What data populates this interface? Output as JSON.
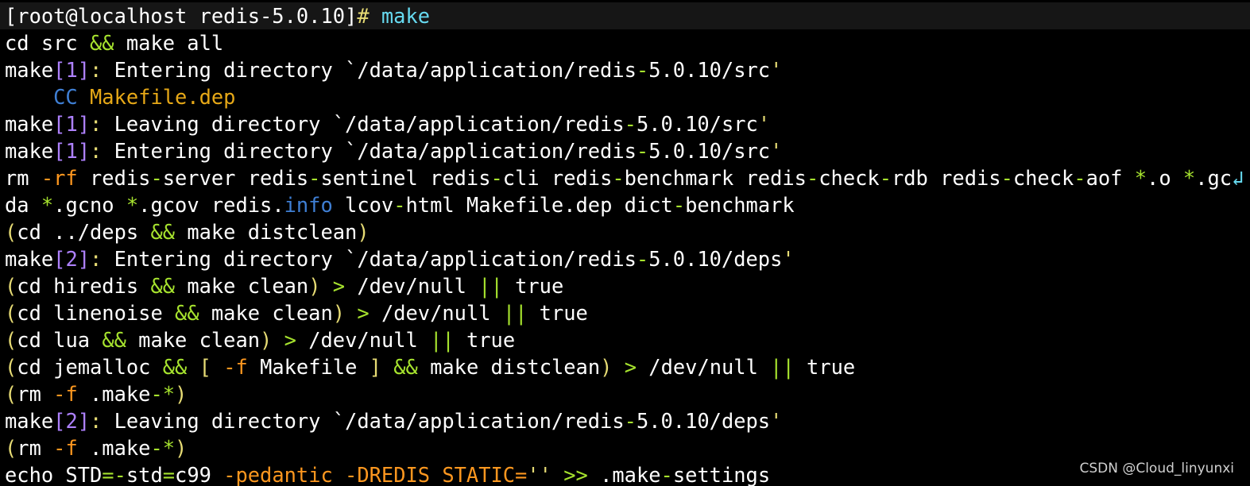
{
  "colors": {
    "background": "#000000",
    "prompt_background": "#161616",
    "text": "#ffffff",
    "operator": "#a6e22e",
    "bracket": "#ae81ff",
    "punctuation": "#e6db74",
    "option": "#fd971f",
    "builtin": "#66d9ef",
    "cc": "#3f7fd4",
    "makefile": "#e6a817",
    "watermark": "#d0d0d0"
  },
  "icons": {
    "wrap_marker": "line-wrap-icon"
  },
  "terminal": {
    "lines": [
      {
        "kind": "prompt",
        "segments": [
          {
            "text": "[root@localhost redis-5.0.10]",
            "color": "text"
          },
          {
            "text": "# ",
            "color": "punctuation"
          },
          {
            "text": "make",
            "color": "builtin"
          }
        ]
      },
      {
        "segments": [
          {
            "text": "cd src ",
            "color": "text"
          },
          {
            "text": "&&",
            "color": "operator"
          },
          {
            "text": " make all",
            "color": "text"
          }
        ]
      },
      {
        "segments": [
          {
            "text": "make",
            "color": "text"
          },
          {
            "text": "[1]",
            "color": "bracket"
          },
          {
            "text": ":",
            "color": "punctuation"
          },
          {
            "text": " Entering directory `/data/application/redis",
            "color": "text"
          },
          {
            "text": "-",
            "color": "operator"
          },
          {
            "text": "5.0.10/src",
            "color": "text"
          },
          {
            "text": "'",
            "color": "punctuation"
          }
        ]
      },
      {
        "segments": [
          {
            "text": "    CC ",
            "color": "cc"
          },
          {
            "text": "Makefile.dep",
            "color": "makefile"
          }
        ]
      },
      {
        "segments": [
          {
            "text": "make",
            "color": "text"
          },
          {
            "text": "[1]",
            "color": "bracket"
          },
          {
            "text": ":",
            "color": "punctuation"
          },
          {
            "text": " Leaving directory `/data/application/redis",
            "color": "text"
          },
          {
            "text": "-",
            "color": "operator"
          },
          {
            "text": "5.0.10/src",
            "color": "text"
          },
          {
            "text": "'",
            "color": "punctuation"
          }
        ]
      },
      {
        "segments": [
          {
            "text": "make",
            "color": "text"
          },
          {
            "text": "[1]",
            "color": "bracket"
          },
          {
            "text": ":",
            "color": "punctuation"
          },
          {
            "text": " Entering directory `/data/application/redis",
            "color": "text"
          },
          {
            "text": "-",
            "color": "operator"
          },
          {
            "text": "5.0.10/src",
            "color": "text"
          },
          {
            "text": "'",
            "color": "punctuation"
          }
        ]
      },
      {
        "segments": [
          {
            "text": "rm ",
            "color": "text"
          },
          {
            "text": "-rf",
            "color": "option"
          },
          {
            "text": " redis",
            "color": "text"
          },
          {
            "text": "-",
            "color": "operator"
          },
          {
            "text": "server redis",
            "color": "text"
          },
          {
            "text": "-",
            "color": "operator"
          },
          {
            "text": "sentinel redis",
            "color": "text"
          },
          {
            "text": "-",
            "color": "operator"
          },
          {
            "text": "cli redis",
            "color": "text"
          },
          {
            "text": "-",
            "color": "operator"
          },
          {
            "text": "benchmark redis",
            "color": "text"
          },
          {
            "text": "-",
            "color": "operator"
          },
          {
            "text": "check",
            "color": "text"
          },
          {
            "text": "-",
            "color": "operator"
          },
          {
            "text": "rdb redis",
            "color": "text"
          },
          {
            "text": "-",
            "color": "operator"
          },
          {
            "text": "check",
            "color": "text"
          },
          {
            "text": "-",
            "color": "operator"
          },
          {
            "text": "aof ",
            "color": "text"
          },
          {
            "text": "*",
            "color": "operator"
          },
          {
            "text": ".o ",
            "color": "text"
          },
          {
            "text": "*",
            "color": "operator"
          },
          {
            "text": ".gc",
            "color": "text"
          },
          {
            "text": "↲",
            "color": "builtin",
            "icon": "line-wrap-icon"
          }
        ]
      },
      {
        "segments": [
          {
            "text": "da ",
            "color": "text"
          },
          {
            "text": "*",
            "color": "operator"
          },
          {
            "text": ".gcno ",
            "color": "text"
          },
          {
            "text": "*",
            "color": "operator"
          },
          {
            "text": ".gcov redis.",
            "color": "text"
          },
          {
            "text": "info",
            "color": "cc"
          },
          {
            "text": " lcov",
            "color": "text"
          },
          {
            "text": "-",
            "color": "operator"
          },
          {
            "text": "html Makefile.dep dict",
            "color": "text"
          },
          {
            "text": "-",
            "color": "operator"
          },
          {
            "text": "benchmark",
            "color": "text"
          }
        ]
      },
      {
        "segments": [
          {
            "text": "(",
            "color": "punctuation"
          },
          {
            "text": "cd ../deps ",
            "color": "text"
          },
          {
            "text": "&&",
            "color": "operator"
          },
          {
            "text": " make distclean",
            "color": "text"
          },
          {
            "text": ")",
            "color": "punctuation"
          }
        ]
      },
      {
        "segments": [
          {
            "text": "make",
            "color": "text"
          },
          {
            "text": "[2]",
            "color": "bracket"
          },
          {
            "text": ":",
            "color": "punctuation"
          },
          {
            "text": " Entering directory `/data/application/redis",
            "color": "text"
          },
          {
            "text": "-",
            "color": "operator"
          },
          {
            "text": "5.0.10/deps",
            "color": "text"
          },
          {
            "text": "'",
            "color": "punctuation"
          }
        ]
      },
      {
        "segments": [
          {
            "text": "(",
            "color": "punctuation"
          },
          {
            "text": "cd hiredis ",
            "color": "text"
          },
          {
            "text": "&&",
            "color": "operator"
          },
          {
            "text": " make clean",
            "color": "text"
          },
          {
            "text": ")",
            "color": "punctuation"
          },
          {
            "text": " ",
            "color": "text"
          },
          {
            "text": ">",
            "color": "operator"
          },
          {
            "text": " /dev/null ",
            "color": "text"
          },
          {
            "text": "||",
            "color": "operator"
          },
          {
            "text": " true",
            "color": "text"
          }
        ]
      },
      {
        "segments": [
          {
            "text": "(",
            "color": "punctuation"
          },
          {
            "text": "cd linenoise ",
            "color": "text"
          },
          {
            "text": "&&",
            "color": "operator"
          },
          {
            "text": " make clean",
            "color": "text"
          },
          {
            "text": ")",
            "color": "punctuation"
          },
          {
            "text": " ",
            "color": "text"
          },
          {
            "text": ">",
            "color": "operator"
          },
          {
            "text": " /dev/null ",
            "color": "text"
          },
          {
            "text": "||",
            "color": "operator"
          },
          {
            "text": " true",
            "color": "text"
          }
        ]
      },
      {
        "segments": [
          {
            "text": "(",
            "color": "punctuation"
          },
          {
            "text": "cd lua ",
            "color": "text"
          },
          {
            "text": "&&",
            "color": "operator"
          },
          {
            "text": " make clean",
            "color": "text"
          },
          {
            "text": ")",
            "color": "punctuation"
          },
          {
            "text": " ",
            "color": "text"
          },
          {
            "text": ">",
            "color": "operator"
          },
          {
            "text": " /dev/null ",
            "color": "text"
          },
          {
            "text": "||",
            "color": "operator"
          },
          {
            "text": " true",
            "color": "text"
          }
        ]
      },
      {
        "segments": [
          {
            "text": "(",
            "color": "punctuation"
          },
          {
            "text": "cd jemalloc ",
            "color": "text"
          },
          {
            "text": "&&",
            "color": "operator"
          },
          {
            "text": " ",
            "color": "text"
          },
          {
            "text": "[",
            "color": "punctuation"
          },
          {
            "text": " ",
            "color": "text"
          },
          {
            "text": "-f",
            "color": "option"
          },
          {
            "text": " Makefile ",
            "color": "text"
          },
          {
            "text": "]",
            "color": "punctuation"
          },
          {
            "text": " ",
            "color": "text"
          },
          {
            "text": "&&",
            "color": "operator"
          },
          {
            "text": " make distclean",
            "color": "text"
          },
          {
            "text": ")",
            "color": "punctuation"
          },
          {
            "text": " ",
            "color": "text"
          },
          {
            "text": ">",
            "color": "operator"
          },
          {
            "text": " /dev/null ",
            "color": "text"
          },
          {
            "text": "||",
            "color": "operator"
          },
          {
            "text": " true",
            "color": "text"
          }
        ]
      },
      {
        "segments": [
          {
            "text": "(",
            "color": "punctuation"
          },
          {
            "text": "rm ",
            "color": "text"
          },
          {
            "text": "-f",
            "color": "option"
          },
          {
            "text": " .make",
            "color": "text"
          },
          {
            "text": "-*",
            "color": "operator"
          },
          {
            "text": ")",
            "color": "punctuation"
          }
        ]
      },
      {
        "segments": [
          {
            "text": "make",
            "color": "text"
          },
          {
            "text": "[2]",
            "color": "bracket"
          },
          {
            "text": ":",
            "color": "punctuation"
          },
          {
            "text": " Leaving directory `/data/application/redis",
            "color": "text"
          },
          {
            "text": "-",
            "color": "operator"
          },
          {
            "text": "5.0.10/deps",
            "color": "text"
          },
          {
            "text": "'",
            "color": "punctuation"
          }
        ]
      },
      {
        "segments": [
          {
            "text": "(",
            "color": "punctuation"
          },
          {
            "text": "rm ",
            "color": "text"
          },
          {
            "text": "-f",
            "color": "option"
          },
          {
            "text": " .make",
            "color": "text"
          },
          {
            "text": "-*",
            "color": "operator"
          },
          {
            "text": ")",
            "color": "punctuation"
          }
        ]
      },
      {
        "segments": [
          {
            "text": "echo STD",
            "color": "text"
          },
          {
            "text": "=-",
            "color": "operator"
          },
          {
            "text": "std",
            "color": "text"
          },
          {
            "text": "=",
            "color": "operator"
          },
          {
            "text": "c99 ",
            "color": "text"
          },
          {
            "text": "-pedantic -DREDIS_STATIC=",
            "color": "option"
          },
          {
            "text": "''",
            "color": "punctuation"
          },
          {
            "text": " ",
            "color": "text"
          },
          {
            "text": ">>",
            "color": "operator"
          },
          {
            "text": " .make",
            "color": "text"
          },
          {
            "text": "-",
            "color": "operator"
          },
          {
            "text": "settings",
            "color": "text"
          }
        ]
      }
    ]
  },
  "watermark": {
    "text": "CSDN @Cloud_linyunxi"
  }
}
